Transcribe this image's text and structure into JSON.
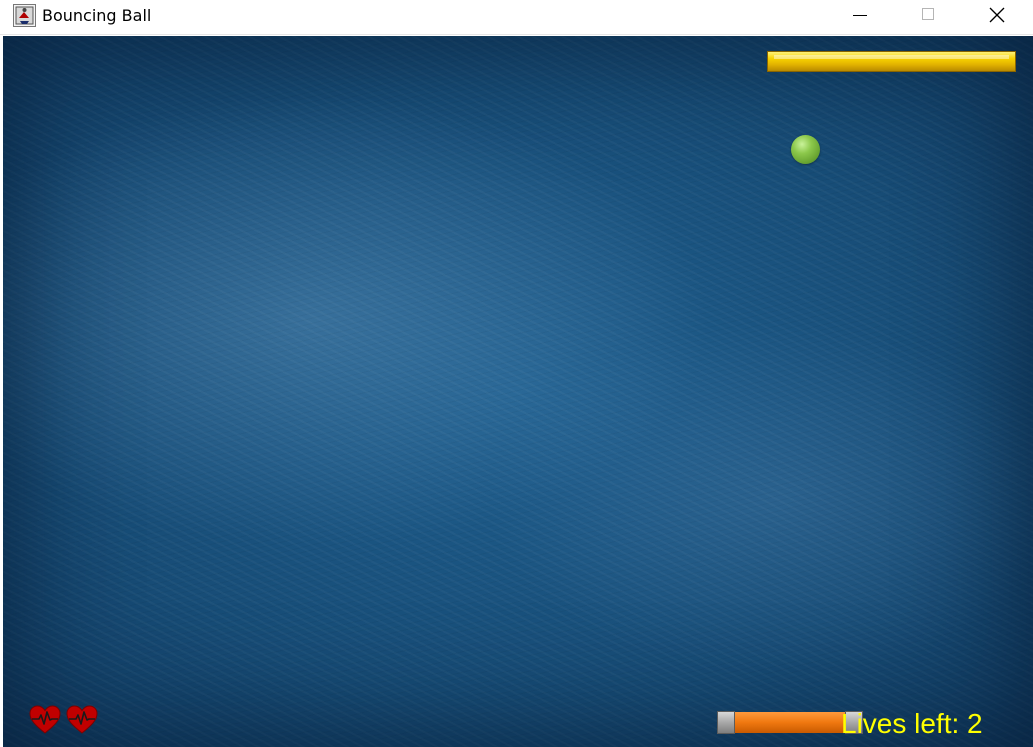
{
  "window": {
    "title": "Bouncing Ball",
    "app_icon": "java-cup-icon",
    "controls": [
      "minimize-icon",
      "maximize-icon",
      "close-icon"
    ]
  },
  "game": {
    "background": "dark-blue-textured",
    "top_bar": {
      "name": "yellow-brick",
      "color": "#F2C900"
    },
    "ball": {
      "color": "#8CC84B"
    },
    "paddle": {
      "body_color": "#F07810",
      "cap_color": "#A8A8A8"
    },
    "hearts": {
      "icon": "heartbeat-heart-icon",
      "count": 2,
      "color": "#C00000"
    },
    "hud": {
      "lives_text": "Lives left: 2",
      "lives": 2,
      "text_color": "#FFFF00"
    }
  }
}
